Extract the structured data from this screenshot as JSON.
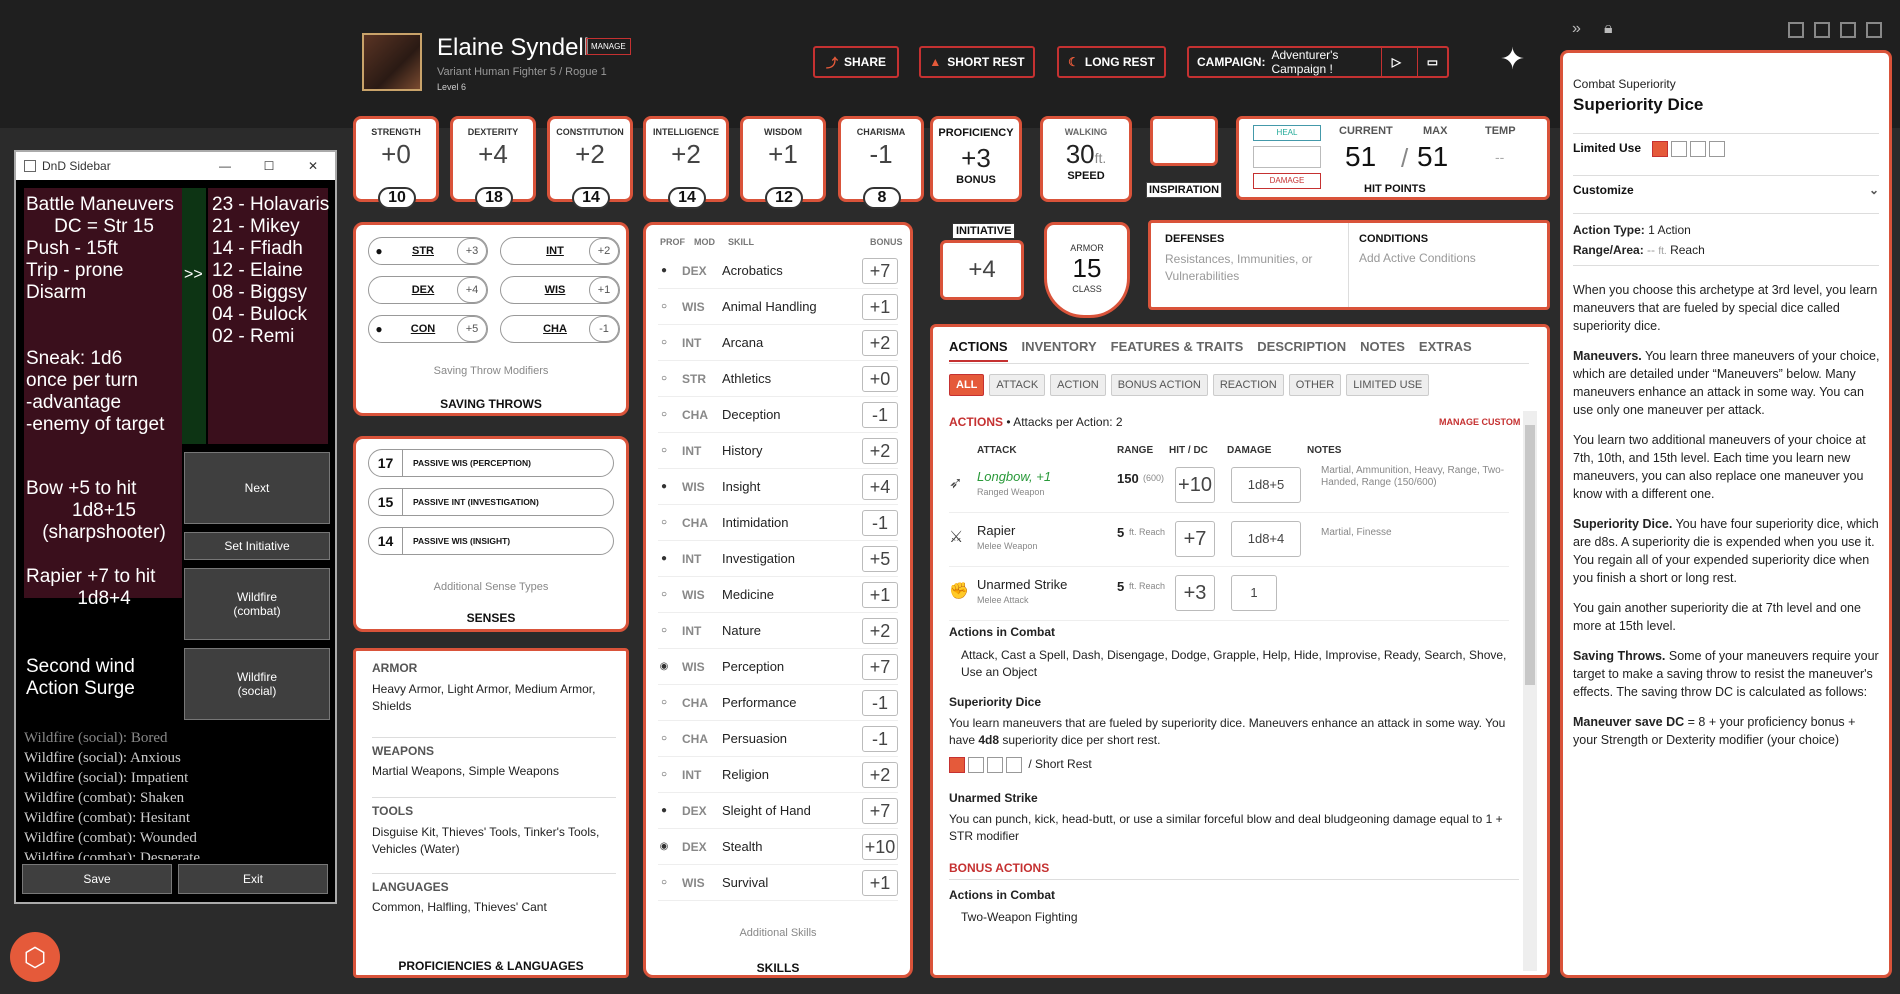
{
  "header": {
    "name": "Elaine Syndell",
    "manage": "MANAGE",
    "race_class": "Variant Human  Fighter 5 / Rogue 1",
    "level": "Level 6",
    "share": "SHARE",
    "short_rest": "SHORT REST",
    "long_rest": "LONG REST",
    "campaign_label": "CAMPAIGN:",
    "campaign_value": "Adventurer's Campaign !"
  },
  "abilities": [
    {
      "label": "STRENGTH",
      "mod": "+0",
      "score": "10"
    },
    {
      "label": "DEXTERITY",
      "mod": "+4",
      "score": "18"
    },
    {
      "label": "CONSTITUTION",
      "mod": "+2",
      "score": "14"
    },
    {
      "label": "INTELLIGENCE",
      "mod": "+2",
      "score": "14"
    },
    {
      "label": "WISDOM",
      "mod": "+1",
      "score": "12"
    },
    {
      "label": "CHARISMA",
      "mod": "-1",
      "score": "8"
    }
  ],
  "proficiency": {
    "label": "PROFICIENCY",
    "value": "+3",
    "sub": "BONUS"
  },
  "walking": {
    "label": "WALKING",
    "value": "30",
    "unit": "ft.",
    "sub": "SPEED"
  },
  "inspiration": "INSPIRATION",
  "hp": {
    "heal": "HEAL",
    "damage": "DAMAGE",
    "current_label": "CURRENT",
    "max_label": "MAX",
    "temp_label": "TEMP",
    "current": "51",
    "sep": "/",
    "max": "51",
    "temp": "--",
    "title": "HIT POINTS"
  },
  "initiative": {
    "label": "INITIATIVE",
    "value": "+4"
  },
  "armor": {
    "label": "ARMOR",
    "value": "15",
    "sub": "CLASS"
  },
  "defenses": {
    "title": "DEFENSES",
    "text": "Resistances, Immunities, or Vulnerabilities"
  },
  "conditions": {
    "title": "CONDITIONS",
    "text": "Add Active Conditions"
  },
  "saving_throws": {
    "items": [
      {
        "name": "STR",
        "val": "+3",
        "prof": true
      },
      {
        "name": "INT",
        "val": "+2",
        "prof": false
      },
      {
        "name": "DEX",
        "val": "+4",
        "prof": false
      },
      {
        "name": "WIS",
        "val": "+1",
        "prof": false
      },
      {
        "name": "CON",
        "val": "+5",
        "prof": true
      },
      {
        "name": "CHA",
        "val": "-1",
        "prof": false
      }
    ],
    "modifiers": "Saving Throw Modifiers",
    "title": "SAVING THROWS"
  },
  "senses": {
    "items": [
      {
        "val": "17",
        "label": "PASSIVE WIS (PERCEPTION)"
      },
      {
        "val": "15",
        "label": "PASSIVE INT (INVESTIGATION)"
      },
      {
        "val": "14",
        "label": "PASSIVE WIS (INSIGHT)"
      }
    ],
    "additional": "Additional Sense Types",
    "title": "SENSES"
  },
  "proficiencies": {
    "armor_t": "ARMOR",
    "armor": "Heavy Armor, Light Armor, Medium Armor, Shields",
    "weapons_t": "WEAPONS",
    "weapons": "Martial Weapons, Simple Weapons",
    "tools_t": "TOOLS",
    "tools": "Disguise Kit, Thieves' Tools, Tinker's Tools, Vehicles (Water)",
    "languages_t": "LANGUAGES",
    "languages": "Common, Halfling, Thieves' Cant",
    "title": "PROFICIENCIES & LANGUAGES"
  },
  "skills": {
    "head_prof": "PROF",
    "head_mod": "MOD",
    "head_skill": "SKILL",
    "head_bonus": "BONUS",
    "items": [
      {
        "dot": "●",
        "mod": "DEX",
        "name": "Acrobatics",
        "bonus": "+7"
      },
      {
        "dot": "○",
        "mod": "WIS",
        "name": "Animal Handling",
        "bonus": "+1"
      },
      {
        "dot": "○",
        "mod": "INT",
        "name": "Arcana",
        "bonus": "+2"
      },
      {
        "dot": "○",
        "mod": "STR",
        "name": "Athletics",
        "bonus": "+0"
      },
      {
        "dot": "○",
        "mod": "CHA",
        "name": "Deception",
        "bonus": "-1"
      },
      {
        "dot": "○",
        "mod": "INT",
        "name": "History",
        "bonus": "+2"
      },
      {
        "dot": "●",
        "mod": "WIS",
        "name": "Insight",
        "bonus": "+4"
      },
      {
        "dot": "○",
        "mod": "CHA",
        "name": "Intimidation",
        "bonus": "-1"
      },
      {
        "dot": "●",
        "mod": "INT",
        "name": "Investigation",
        "bonus": "+5"
      },
      {
        "dot": "○",
        "mod": "WIS",
        "name": "Medicine",
        "bonus": "+1"
      },
      {
        "dot": "○",
        "mod": "INT",
        "name": "Nature",
        "bonus": "+2"
      },
      {
        "dot": "◉",
        "mod": "WIS",
        "name": "Perception",
        "bonus": "+7"
      },
      {
        "dot": "○",
        "mod": "CHA",
        "name": "Performance",
        "bonus": "-1"
      },
      {
        "dot": "○",
        "mod": "CHA",
        "name": "Persuasion",
        "bonus": "-1"
      },
      {
        "dot": "○",
        "mod": "INT",
        "name": "Religion",
        "bonus": "+2"
      },
      {
        "dot": "●",
        "mod": "DEX",
        "name": "Sleight of Hand",
        "bonus": "+7"
      },
      {
        "dot": "◉",
        "mod": "DEX",
        "name": "Stealth",
        "bonus": "+10"
      },
      {
        "dot": "○",
        "mod": "WIS",
        "name": "Survival",
        "bonus": "+1"
      }
    ],
    "additional": "Additional Skills",
    "title": "SKILLS"
  },
  "tabs": [
    "ACTIONS",
    "INVENTORY",
    "FEATURES & TRAITS",
    "DESCRIPTION",
    "NOTES",
    "EXTRAS"
  ],
  "filters": [
    "ALL",
    "ATTACK",
    "ACTION",
    "BONUS ACTION",
    "REACTION",
    "OTHER",
    "LIMITED USE"
  ],
  "actions": {
    "title": "ACTIONS",
    "per": "• Attacks per Action: 2",
    "manage": "MANAGE CUSTOM",
    "col_attack": "ATTACK",
    "col_range": "RANGE",
    "col_hit": "HIT / DC",
    "col_damage": "DAMAGE",
    "col_notes": "NOTES",
    "attacks": [
      {
        "name": "Longbow, +1",
        "sub": "Ranged Weapon",
        "range": "150",
        "range2": "(600)",
        "hit": "+10",
        "damage": "1d8+5",
        "notes": "Martial, Ammunition, Heavy, Range, Two-Handed, Range (150/600)"
      },
      {
        "name": "Rapier",
        "sub": "Melee Weapon",
        "range": "5",
        "range2": "ft. Reach",
        "hit": "+7",
        "damage": "1d8+4",
        "notes": "Martial, Finesse"
      },
      {
        "name": "Unarmed Strike",
        "sub": "Melee Attack",
        "range": "5",
        "range2": "ft. Reach",
        "hit": "+3",
        "damage": "1",
        "notes": ""
      }
    ],
    "in_combat_t": "Actions in Combat",
    "in_combat": "Attack, Cast a Spell, Dash, Disengage, Dodge, Grapple, Help, Hide, Improvise, Ready, Search, Shove, Use an Object",
    "sup_t": "Superiority Dice",
    "sup_text_a": "You learn maneuvers that are fueled by superiority dice. Maneuvers enhance an attack in some way. You have ",
    "sup_bold": "4d8",
    "sup_text_b": " superiority dice per short rest.",
    "short_rest": "/ Short Rest",
    "unarmed_t": "Unarmed Strike",
    "unarmed": "You can punch, kick, head-butt, or use a similar forceful blow and deal bludgeoning damage equal to 1 + STR modifier",
    "bonus_t": "BONUS ACTIONS",
    "bonus_sub": "Actions in Combat",
    "bonus_item": "Two-Weapon Fighting"
  },
  "right": {
    "kicker": "Combat Superiority",
    "title": "Superiority Dice",
    "limited": "Limited Use",
    "customize": "Customize",
    "action_type_l": "Action Type:",
    "action_type": "1 Action",
    "range_l": "Range/Area:",
    "range_dash": "--",
    "range_unit": "ft.",
    "range": "Reach",
    "p1": "When you choose this archetype at 3rd level, you learn maneuvers that are fueled by special dice called superiority dice.",
    "p2_b": "Maneuvers.",
    "p2": " You learn three maneuvers of your choice, which are detailed under “Maneuvers” below. Many maneuvers enhance an attack in some way. You can use only one maneuver per attack.",
    "p3": "You learn two additional maneuvers of your choice at 7th, 10th, and 15th level. Each time you learn new maneuvers, you can also replace one maneuver you know with a different one.",
    "p4_b": "Superiority Dice.",
    "p4": " You have four superiority dice, which are d8s. A superiority die is expended when you use it. You regain all of your expended superiority dice when you finish a short or long rest.",
    "p5": "You gain another superiority die at 7th level and one more at 15th level.",
    "p6_b": "Saving Throws.",
    "p6": " Some of your maneuvers require your target to make a saving throw to resist the maneuver's effects. The saving throw DC is calculated as follows:",
    "p7_b": "Maneuver save DC",
    "p7": " = 8 + your proficiency bonus + your Strength or Dexterity modifier (your choice)"
  },
  "sidebar": {
    "title": "DnD Sidebar",
    "left_lines": [
      "Battle Maneuvers",
      "DC = Str 15",
      "Push - 15ft",
      "Trip - prone",
      "Disarm"
    ],
    "sneak_lines": [
      "Sneak:  1d6",
      "once per turn",
      "-advantage",
      "-enemy of target"
    ],
    "bow_lines": [
      "Bow +5 to hit",
      "1d8+15",
      "(sharpshooter)"
    ],
    "rapier_lines": [
      "Rapier +7 to hit",
      "1d8+4"
    ],
    "wind_lines": [
      "Second wind",
      "Action Surge"
    ],
    "marker": ">>",
    "init_list": [
      "23 - Holavaris",
      "21 - Mikey",
      "14 - Ffiadh",
      "12 - Elaine",
      "08 - Biggsy",
      "04 - Bulock",
      "02 - Remi"
    ],
    "next": "Next",
    "set_init": "Set Initiative",
    "wild_combat": "Wildfire\n(combat)",
    "wild_social": "Wildfire\n(social)",
    "log": [
      "Wildfire (social): Bored",
      "Wildfire (social): Anxious",
      "Wildfire (social): Impatient",
      "Wildfire (combat): Shaken",
      "Wildfire (combat): Hesitant",
      "Wildfire (combat): Wounded",
      "Wildfire (combat): Desperate"
    ],
    "save": "Save",
    "exit": "Exit"
  }
}
